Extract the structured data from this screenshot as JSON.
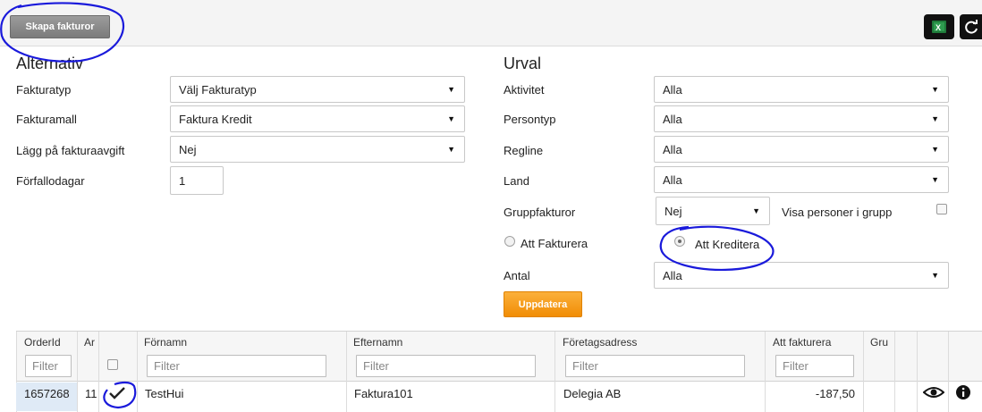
{
  "toolbar": {
    "create_invoices_label": "Skapa fakturor",
    "excel_icon": "excel-export-icon",
    "refresh_icon": "refresh-icon"
  },
  "alternativ": {
    "heading": "Alternativ",
    "fields": [
      {
        "label": "Fakturatyp",
        "value": "Välj Fakturatyp"
      },
      {
        "label": "Fakturamall",
        "value": "Faktura Kredit"
      },
      {
        "label": "Lägg på fakturaavgift",
        "value": "Nej"
      },
      {
        "label": "Förfallodagar",
        "value": "1"
      }
    ]
  },
  "urval": {
    "heading": "Urval",
    "fields": [
      {
        "label": "Aktivitet",
        "value": "Alla"
      },
      {
        "label": "Persontyp",
        "value": "Alla"
      },
      {
        "label": "Regline",
        "value": "Alla"
      },
      {
        "label": "Land",
        "value": "Alla"
      }
    ],
    "group_invoices": {
      "label": "Gruppfakturor",
      "value": "Nej"
    },
    "show_persons_label": "Visa personer i grupp",
    "radio_invoice_label": "Att Fakturera",
    "radio_credit_label": "Att Kreditera",
    "count": {
      "label": "Antal",
      "value": "Alla"
    },
    "update_label": "Uppdatera"
  },
  "grid": {
    "headers": [
      "OrderId",
      "Ar",
      "",
      "Förnamn",
      "Efternamn",
      "Företagsadress",
      "Att fakturera",
      "Gru"
    ],
    "filter_placeholder": "Filter",
    "rows": [
      {
        "order_id": "1657268",
        "ar": "11",
        "first_name": "TestHui",
        "last_name": "Faktura101",
        "company_address": "Delegia AB",
        "amount": "-187,50"
      }
    ]
  },
  "colors": {
    "accent_orange": "#f5a01a",
    "annotation_blue": "#1a1adb"
  }
}
